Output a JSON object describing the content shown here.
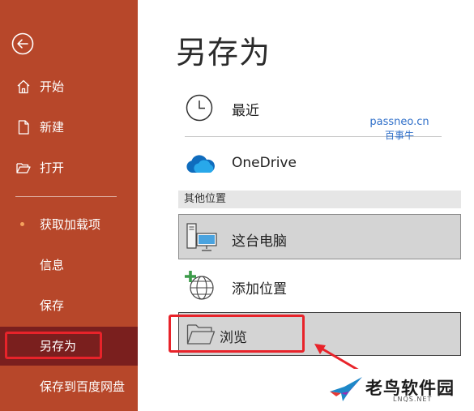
{
  "sidebar": {
    "items": [
      {
        "label": "开始",
        "icon": "home-icon"
      },
      {
        "label": "新建",
        "icon": "new-document-icon"
      },
      {
        "label": "打开",
        "icon": "open-folder-icon"
      },
      {
        "label": "获取加载项"
      },
      {
        "label": "信息"
      },
      {
        "label": "保存"
      },
      {
        "label": "另存为",
        "selected": true
      },
      {
        "label": "保存到百度网盘"
      }
    ]
  },
  "main": {
    "title": "另存为",
    "locations": [
      {
        "label": "最近",
        "icon": "clock-icon"
      },
      {
        "label": "OneDrive",
        "icon": "onedrive-cloud-icon"
      }
    ],
    "section_header": "其他位置",
    "other_locations": [
      {
        "label": "这台电脑",
        "icon": "computer-icon"
      },
      {
        "label": "添加位置",
        "icon": "add-location-globe-icon"
      },
      {
        "label": "浏览",
        "icon": "folder-icon"
      }
    ]
  },
  "watermark": {
    "line1": "passneo.cn",
    "line2": "百事牛"
  },
  "brand": {
    "name": "老鸟软件园",
    "sub": "LNQS.NET"
  },
  "colors": {
    "sidebar": "#b7472a",
    "selected": "#7a1f1e",
    "highlight": "#e8232a",
    "accent_blue": "#0f6cbd"
  }
}
